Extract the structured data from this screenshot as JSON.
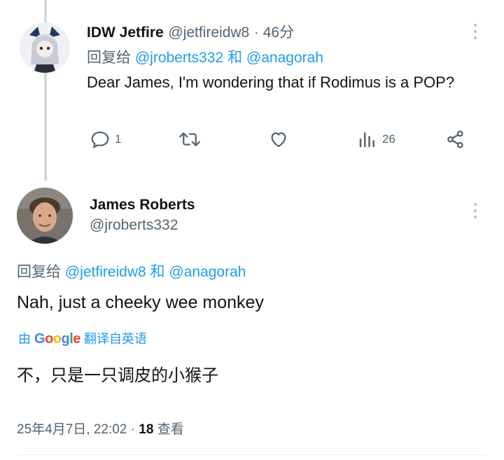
{
  "tweet1": {
    "display_name": "IDW Jetfire",
    "handle": "@jetfireidw8",
    "time": "· 46分",
    "reply_prefix": "回复给",
    "reply_user1": "@jroberts332",
    "reply_and": "和",
    "reply_user2": "@anagorah",
    "text": "Dear James, I'm wondering that if Rodimus is a POP?",
    "actions": {
      "reply_icon": "reply-icon",
      "reply_count": "1",
      "retweet_icon": "retweet-icon",
      "like_icon": "heart-icon",
      "views_icon": "views-icon",
      "views_count": "26",
      "share_icon": "share-icon"
    }
  },
  "tweet2": {
    "display_name": "James Roberts",
    "handle": "@jroberts332",
    "reply_prefix": "回复给",
    "reply_user1": "@jetfireidw8",
    "reply_and": "和",
    "reply_user2": "@anagorah",
    "text": "Nah, just a cheeky wee monkey",
    "translation_prefix": "由",
    "translation_brand": "Google",
    "translation_suffix": "翻译自英语",
    "translated_text": "不，只是一只调皮的小猴子",
    "date": "25年4月7日, 22:02 ·",
    "views_count": "18",
    "views_label": "查看"
  },
  "colors": {
    "link": "#1d9bf0",
    "secondary": "#536471",
    "primary": "#0f1419",
    "thread_line": "#cfd9de"
  }
}
